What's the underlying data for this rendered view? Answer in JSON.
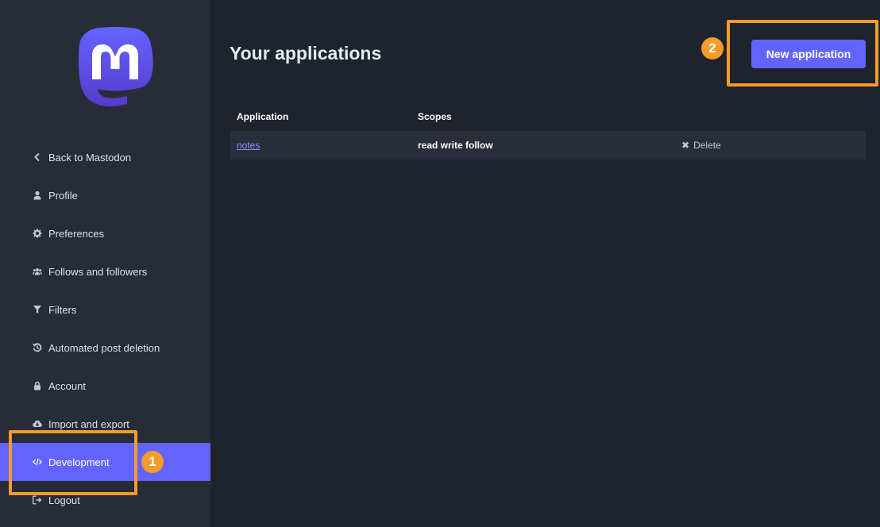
{
  "sidebar": {
    "items": [
      {
        "label": "Back to Mastodon",
        "icon": "chevron-left-icon"
      },
      {
        "label": "Profile",
        "icon": "user-icon"
      },
      {
        "label": "Preferences",
        "icon": "gear-icon"
      },
      {
        "label": "Follows and followers",
        "icon": "users-icon"
      },
      {
        "label": "Filters",
        "icon": "filter-icon"
      },
      {
        "label": "Automated post deletion",
        "icon": "history-icon"
      },
      {
        "label": "Account",
        "icon": "lock-icon"
      },
      {
        "label": "Import and export",
        "icon": "cloud-download-icon"
      },
      {
        "label": "Development",
        "icon": "code-icon",
        "active": true
      },
      {
        "label": "Logout",
        "icon": "sign-out-icon"
      }
    ]
  },
  "main": {
    "title": "Your applications",
    "new_button": "New application",
    "table": {
      "headers": [
        "Application",
        "Scopes"
      ],
      "rows": [
        {
          "name": "notes",
          "scopes": "read write follow",
          "action": "Delete"
        }
      ]
    }
  },
  "annotations": {
    "marker_1": "1",
    "marker_2": "2"
  },
  "colors": {
    "accent": "#6364ff",
    "highlight": "#f59b2b",
    "sidebar_bg": "#282c37",
    "page_bg": "#1f232b"
  }
}
